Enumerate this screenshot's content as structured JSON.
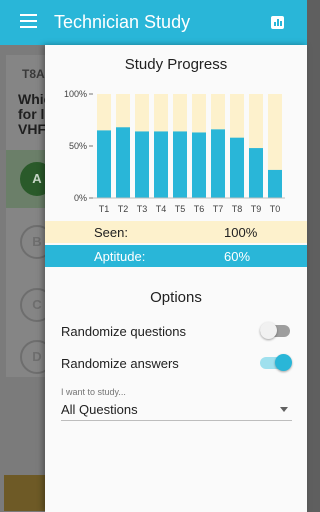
{
  "app": {
    "title": "Technician Study"
  },
  "background": {
    "question_id": "T8A",
    "question_lines": [
      "Whic",
      "for lo",
      "VHF"
    ],
    "answers": [
      "A",
      "B",
      "C",
      "D"
    ]
  },
  "drawer": {
    "progress_title": "Study Progress",
    "chart_data": {
      "type": "bar",
      "title": "",
      "categories": [
        "T1",
        "T2",
        "T3",
        "T4",
        "T5",
        "T6",
        "T7",
        "T8",
        "T9",
        "T0"
      ],
      "y_ticks": [
        "0%",
        "50%",
        "100%"
      ],
      "ylim": [
        0,
        100
      ],
      "series": [
        {
          "name": "",
          "values": [
            65,
            68,
            64,
            64,
            64,
            63,
            66,
            58,
            48,
            27
          ],
          "color": "#29b6d8"
        },
        {
          "name": "",
          "values": [
            100,
            100,
            100,
            100,
            100,
            100,
            100,
            100,
            100,
            100
          ],
          "color": "#fdf1cc"
        }
      ],
      "grid": false,
      "legend": "none"
    },
    "stats": {
      "seen_label": "Seen:",
      "seen_value": "100%",
      "aptitude_label": "Aptitude:",
      "aptitude_value": "60%"
    },
    "options_title": "Options",
    "options": {
      "randomize_questions_label": "Randomize questions",
      "randomize_questions_on": false,
      "randomize_answers_label": "Randomize answers",
      "randomize_answers_on": true
    },
    "study": {
      "label": "I want to study...",
      "value": "All Questions"
    }
  },
  "colors": {
    "accent": "#29b6d8",
    "seen_fill": "#fdf1cc"
  }
}
